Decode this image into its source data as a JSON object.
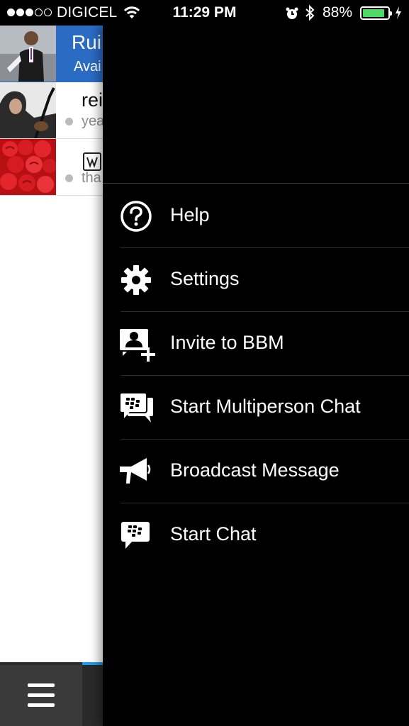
{
  "status_bar": {
    "carrier": "DIGICEL",
    "time": "11:29 PM",
    "battery_percent": "88%",
    "signal_bars_filled": 3,
    "signal_bars_total": 5,
    "battery_level": 0.88,
    "icons": [
      "wifi-icon",
      "alarm-icon",
      "bluetooth-icon",
      "battery-icon",
      "charging-icon"
    ]
  },
  "chat_list": {
    "my_profile": {
      "name": "Rui",
      "status": "Avai"
    },
    "contacts": [
      {
        "name": "rei",
        "preview": "yea"
      },
      {
        "name": "",
        "preview": "tha"
      }
    ],
    "colors": {
      "profile_bg": "#2a6cc4",
      "accent": "#1c9be6"
    }
  },
  "menu": {
    "items": [
      {
        "label": "Help",
        "icon": "help-icon"
      },
      {
        "label": "Settings",
        "icon": "gear-icon"
      },
      {
        "label": "Invite to BBM",
        "icon": "add-contact-icon"
      },
      {
        "label": "Start Multiperson Chat",
        "icon": "multiperson-chat-icon"
      },
      {
        "label": "Broadcast Message",
        "icon": "megaphone-icon"
      },
      {
        "label": "Start Chat",
        "icon": "chat-bubble-icon"
      }
    ]
  },
  "bottom_bar": {
    "menu_icon": "hamburger-menu-icon"
  }
}
